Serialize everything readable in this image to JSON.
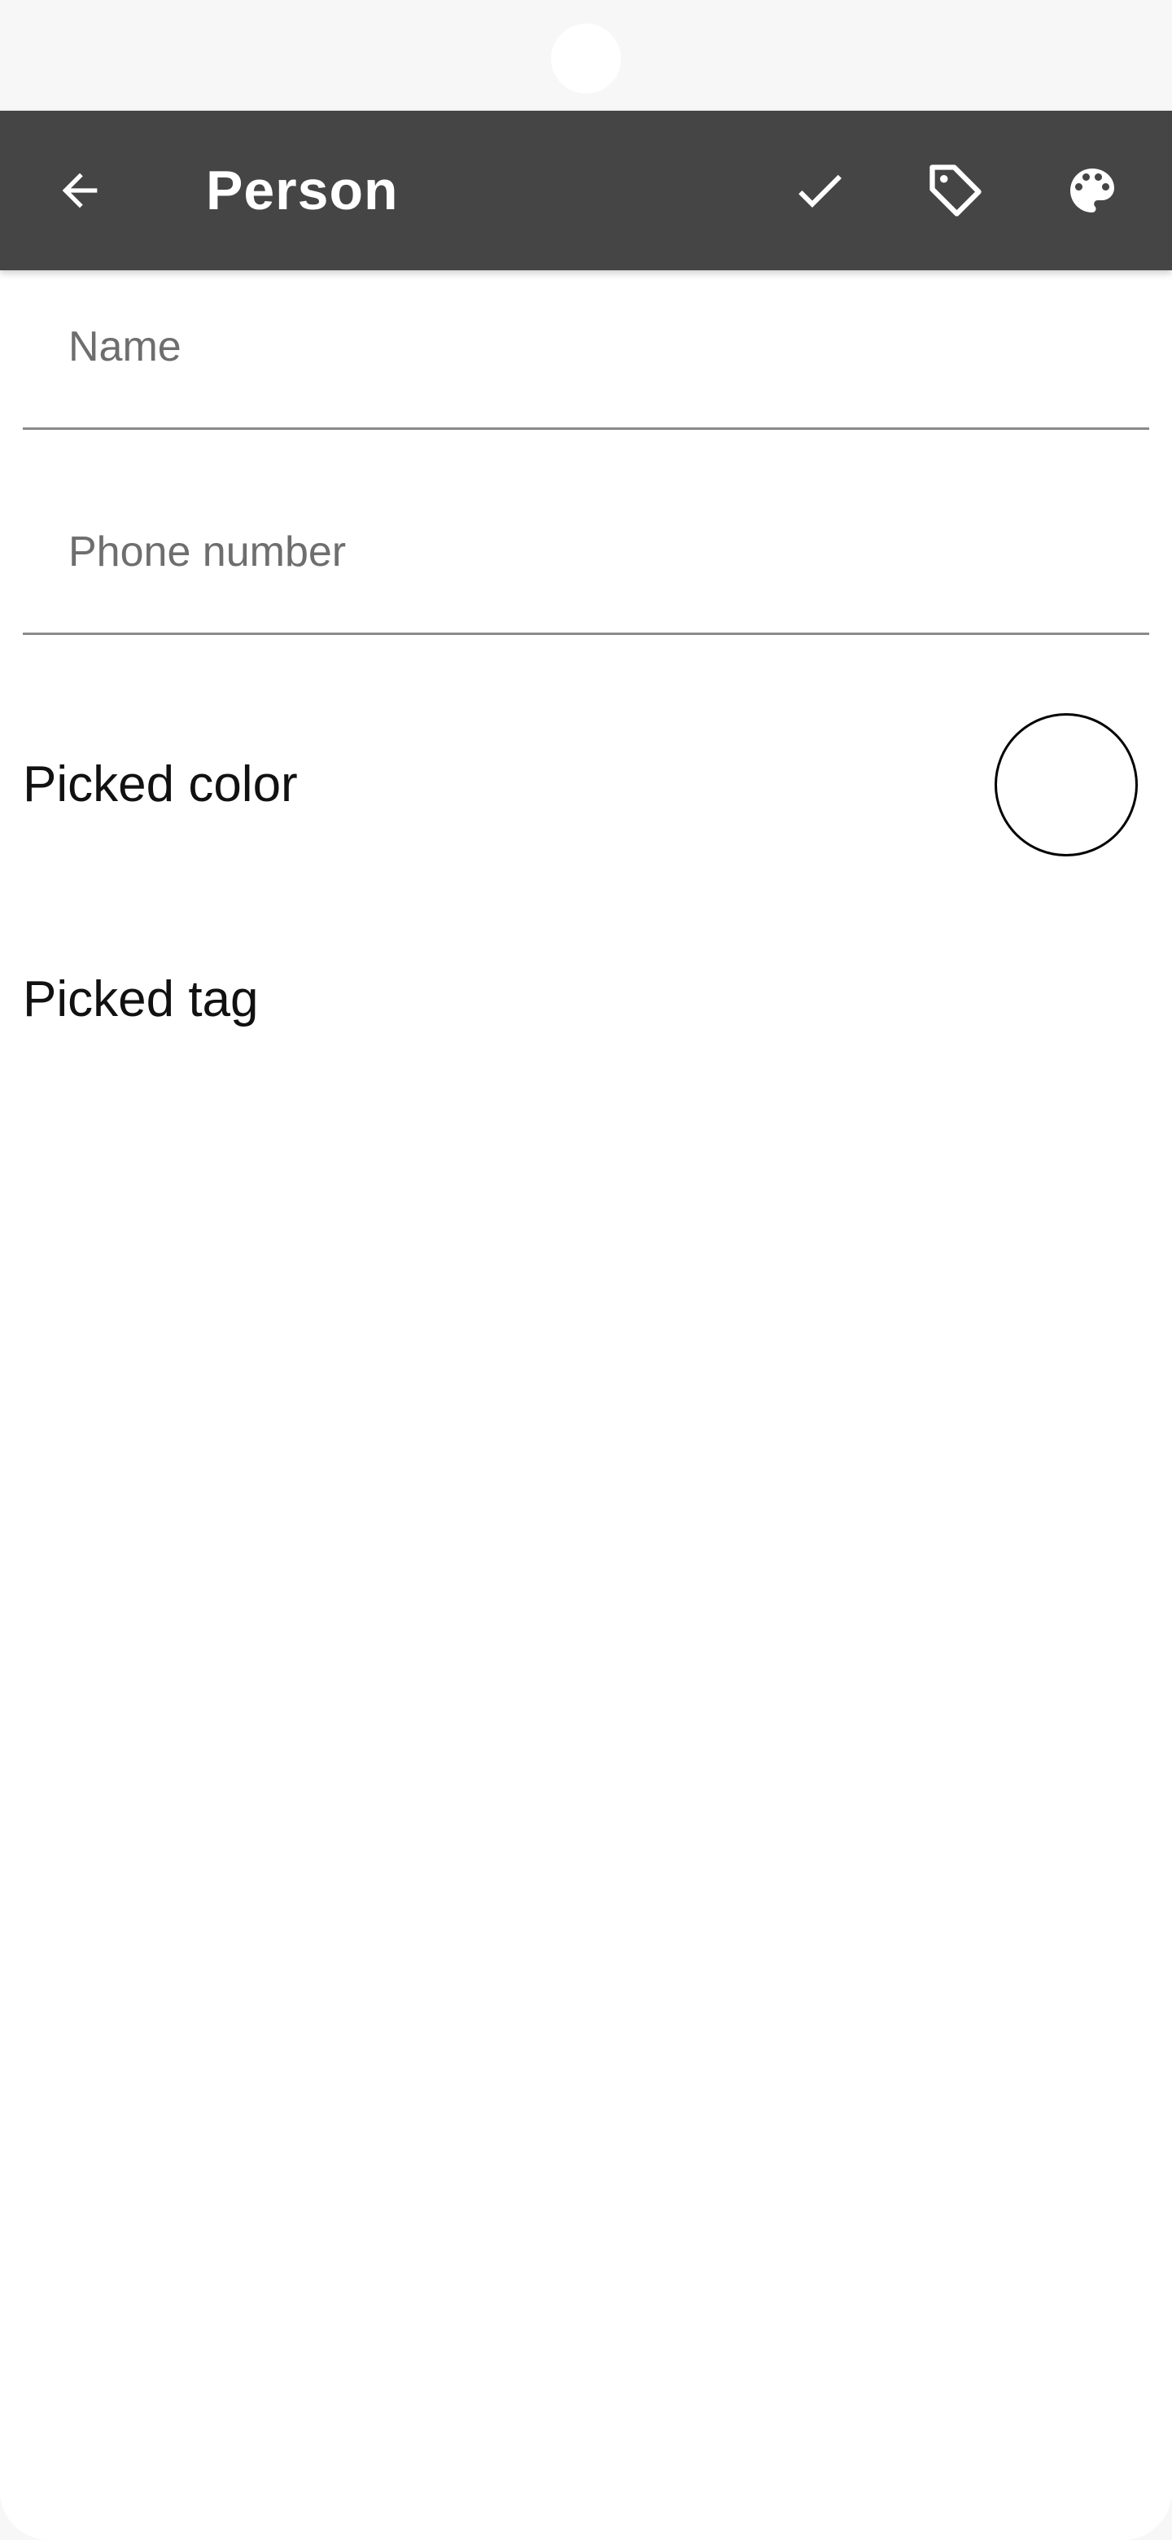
{
  "app_bar": {
    "title": "Person",
    "background_color": "#454545",
    "icons": {
      "back": "arrow-back-icon",
      "confirm": "check-icon",
      "tag": "tag-icon",
      "color": "palette-icon"
    }
  },
  "form": {
    "name_placeholder": "Name",
    "name_value": "",
    "phone_placeholder": "Phone number",
    "phone_value": ""
  },
  "picked": {
    "color_label": "Picked color",
    "color_value": "#ffffff",
    "tag_label": "Picked tag"
  }
}
